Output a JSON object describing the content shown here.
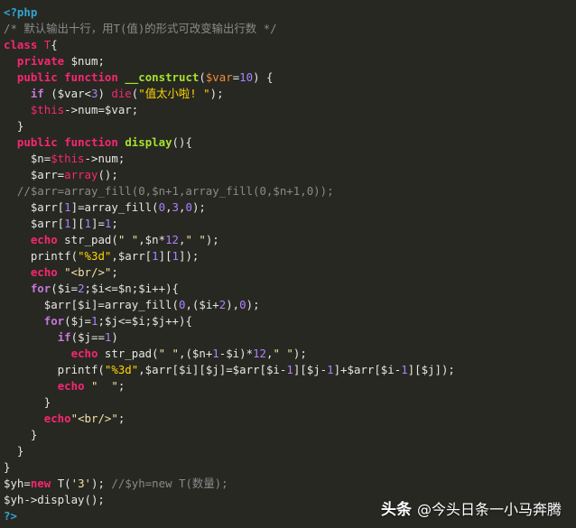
{
  "code": {
    "lines": [
      [
        [
          "<?php",
          "tag"
        ]
      ],
      [
        [
          "/* 默认输出十行，用T(值)的形式可改变输出行数 */",
          "comment"
        ]
      ],
      [
        [
          "class",
          "kw"
        ],
        [
          " ",
          "plain"
        ],
        [
          "T",
          "cls"
        ],
        [
          "{",
          "plain"
        ]
      ],
      [
        [
          "  ",
          "plain"
        ],
        [
          "private",
          "kw"
        ],
        [
          " $num;",
          "plain"
        ]
      ],
      [
        [
          "  ",
          "plain"
        ],
        [
          "public",
          "kw"
        ],
        [
          " ",
          "plain"
        ],
        [
          "function",
          "kw"
        ],
        [
          " ",
          "plain"
        ],
        [
          "__construct",
          "fn"
        ],
        [
          "(",
          "plain"
        ],
        [
          "$var",
          "sv"
        ],
        [
          "=",
          "plain"
        ],
        [
          "10",
          "num"
        ],
        [
          ") {",
          "plain"
        ]
      ],
      [
        [
          "    ",
          "plain"
        ],
        [
          "if",
          "kwp"
        ],
        [
          " ($var<",
          "plain"
        ],
        [
          "3",
          "num"
        ],
        [
          ") ",
          "plain"
        ],
        [
          "die",
          "die"
        ],
        [
          "(",
          "plain"
        ],
        [
          "\"值太小啦! \"",
          "strh"
        ],
        [
          ");",
          "plain"
        ]
      ],
      [
        [
          "    ",
          "plain"
        ],
        [
          "$this",
          "this"
        ],
        [
          "->num=$var;",
          "plain"
        ]
      ],
      [
        [
          "  }",
          "plain"
        ]
      ],
      [
        [
          "  ",
          "plain"
        ],
        [
          "public",
          "kw"
        ],
        [
          " ",
          "plain"
        ],
        [
          "function",
          "kw"
        ],
        [
          " ",
          "plain"
        ],
        [
          "display",
          "fn"
        ],
        [
          "(){",
          "plain"
        ]
      ],
      [
        [
          "    $n=",
          "plain"
        ],
        [
          "$this",
          "this"
        ],
        [
          "->num;",
          "plain"
        ]
      ],
      [
        [
          "    $arr=",
          "plain"
        ],
        [
          "array",
          "array"
        ],
        [
          "();",
          "plain"
        ]
      ],
      [
        [
          "  //$arr=array_fill(0,$n+1,array_fill(0,$n+1,0));",
          "comment"
        ]
      ],
      [
        [
          "    $arr[",
          "plain"
        ],
        [
          "1",
          "num"
        ],
        [
          "]=array_fill(",
          "plain"
        ],
        [
          "0",
          "num"
        ],
        [
          ",",
          "plain"
        ],
        [
          "3",
          "num"
        ],
        [
          ",",
          "plain"
        ],
        [
          "0",
          "num"
        ],
        [
          ");",
          "plain"
        ]
      ],
      [
        [
          "    $arr[",
          "plain"
        ],
        [
          "1",
          "num"
        ],
        [
          "][",
          "plain"
        ],
        [
          "1",
          "num"
        ],
        [
          "]=",
          "plain"
        ],
        [
          "1",
          "num"
        ],
        [
          ";",
          "plain"
        ]
      ],
      [
        [
          "    ",
          "plain"
        ],
        [
          "echo",
          "kw"
        ],
        [
          " str_pad(",
          "plain"
        ],
        [
          "\" \"",
          "str"
        ],
        [
          ",$n*",
          "plain"
        ],
        [
          "12",
          "num"
        ],
        [
          ",",
          "plain"
        ],
        [
          "\" \"",
          "str"
        ],
        [
          ");",
          "plain"
        ]
      ],
      [
        [
          "    printf(",
          "plain"
        ],
        [
          "\"%3d\"",
          "strh"
        ],
        [
          ",$arr[",
          "plain"
        ],
        [
          "1",
          "num"
        ],
        [
          "][",
          "plain"
        ],
        [
          "1",
          "num"
        ],
        [
          "]);",
          "plain"
        ]
      ],
      [
        [
          "    ",
          "plain"
        ],
        [
          "echo",
          "kw"
        ],
        [
          " ",
          "plain"
        ],
        [
          "\"<br/>\"",
          "str"
        ],
        [
          ";",
          "plain"
        ]
      ],
      [
        [
          "    ",
          "plain"
        ],
        [
          "for",
          "kwp"
        ],
        [
          "($i=",
          "plain"
        ],
        [
          "2",
          "num"
        ],
        [
          ";$i<=$n;$i++){",
          "plain"
        ]
      ],
      [
        [
          "      $arr[$i]=array_fill(",
          "plain"
        ],
        [
          "0",
          "num"
        ],
        [
          ",($i+",
          "plain"
        ],
        [
          "2",
          "num"
        ],
        [
          "),",
          "plain"
        ],
        [
          "0",
          "num"
        ],
        [
          ");",
          "plain"
        ]
      ],
      [
        [
          "      ",
          "plain"
        ],
        [
          "for",
          "kwp"
        ],
        [
          "($j=",
          "plain"
        ],
        [
          "1",
          "num"
        ],
        [
          ";$j<=$i;$j++){",
          "plain"
        ]
      ],
      [
        [
          "        ",
          "plain"
        ],
        [
          "if",
          "kwp"
        ],
        [
          "($j==",
          "plain"
        ],
        [
          "1",
          "num"
        ],
        [
          ")",
          "plain"
        ]
      ],
      [
        [
          "          ",
          "plain"
        ],
        [
          "echo",
          "kw"
        ],
        [
          " str_pad(",
          "plain"
        ],
        [
          "\" \"",
          "str"
        ],
        [
          ",($n+",
          "plain"
        ],
        [
          "1",
          "num"
        ],
        [
          "-$i)*",
          "plain"
        ],
        [
          "12",
          "num"
        ],
        [
          ",",
          "plain"
        ],
        [
          "\" \"",
          "str"
        ],
        [
          ");",
          "plain"
        ]
      ],
      [
        [
          "        printf(",
          "plain"
        ],
        [
          "\"%3d\"",
          "strh"
        ],
        [
          ",$arr[$i][$j]=$arr[$i-",
          "plain"
        ],
        [
          "1",
          "num"
        ],
        [
          "][$j-",
          "plain"
        ],
        [
          "1",
          "num"
        ],
        [
          "]+$arr[$i-",
          "plain"
        ],
        [
          "1",
          "num"
        ],
        [
          "][$j]);",
          "plain"
        ]
      ],
      [
        [
          "        ",
          "plain"
        ],
        [
          "echo",
          "kw"
        ],
        [
          " ",
          "plain"
        ],
        [
          "\"  \"",
          "str"
        ],
        [
          ";",
          "plain"
        ]
      ],
      [
        [
          "      }",
          "plain"
        ]
      ],
      [
        [
          "      ",
          "plain"
        ],
        [
          "echo",
          "kw"
        ],
        [
          "\"<br/>\"",
          "str"
        ],
        [
          ";",
          "plain"
        ]
      ],
      [
        [
          "    }",
          "plain"
        ]
      ],
      [
        [
          "  }",
          "plain"
        ]
      ],
      [
        [
          "}",
          "plain"
        ]
      ],
      [
        [
          "$yh=",
          "plain"
        ],
        [
          "new",
          "kw"
        ],
        [
          " T(",
          "plain"
        ],
        [
          "'3'",
          "str"
        ],
        [
          "); ",
          "plain"
        ],
        [
          "//$yh=new T(数量);",
          "comment"
        ]
      ],
      [
        [
          "$yh->display();",
          "plain"
        ]
      ],
      [
        [
          "?>",
          "tag"
        ]
      ]
    ]
  },
  "watermark": {
    "brand": "头条",
    "handle": "@今头日条一小马奔腾"
  }
}
